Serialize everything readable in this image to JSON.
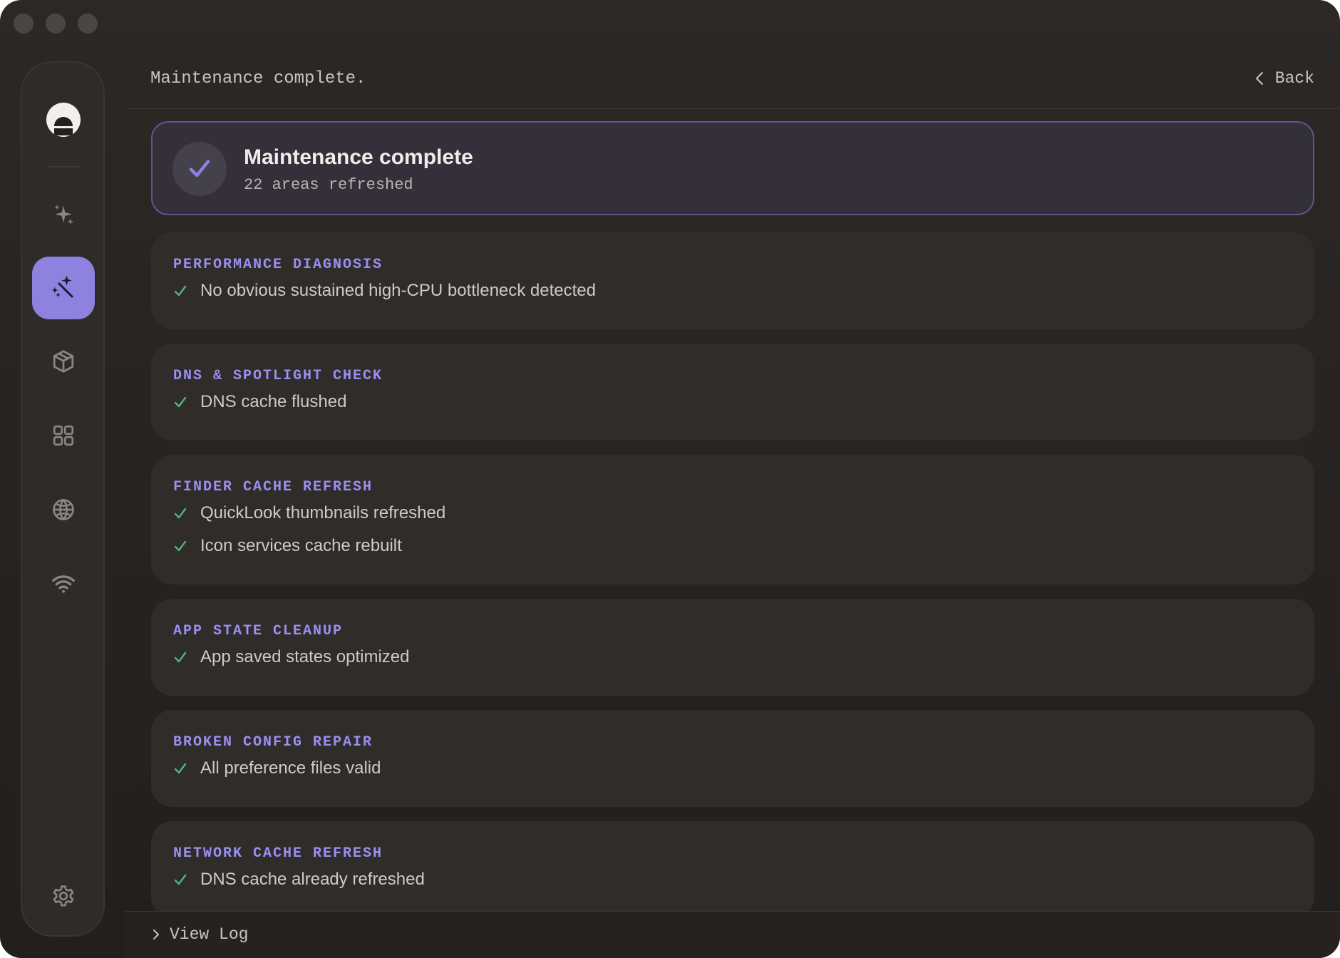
{
  "header": {
    "title": "Maintenance complete.",
    "back_label": "Back"
  },
  "summary": {
    "title": "Maintenance complete",
    "subtitle": "22 areas refreshed"
  },
  "sidebar": {
    "items": [
      {
        "icon": "sparkles-icon",
        "active": false
      },
      {
        "icon": "magic-wand-icon",
        "active": true
      },
      {
        "icon": "package-icon",
        "active": false
      },
      {
        "icon": "grid-icon",
        "active": false
      },
      {
        "icon": "globe-icon",
        "active": false
      },
      {
        "icon": "wifi-icon",
        "active": false
      }
    ],
    "settings_icon": "gear-icon"
  },
  "sections": [
    {
      "title": "PERFORMANCE DIAGNOSIS",
      "items": [
        "No obvious sustained high-CPU bottleneck detected"
      ]
    },
    {
      "title": "DNS & SPOTLIGHT CHECK",
      "items": [
        "DNS cache flushed"
      ]
    },
    {
      "title": "FINDER CACHE REFRESH",
      "items": [
        "QuickLook thumbnails refreshed",
        "Icon services cache rebuilt"
      ]
    },
    {
      "title": "APP STATE CLEANUP",
      "items": [
        "App saved states optimized"
      ]
    },
    {
      "title": "BROKEN CONFIG REPAIR",
      "items": [
        "All preference files valid"
      ]
    },
    {
      "title": "NETWORK CACHE REFRESH",
      "items": [
        "DNS cache already refreshed"
      ]
    }
  ],
  "footer": {
    "view_log_label": "View Log"
  },
  "colors": {
    "accent": "#8d82e0",
    "section_title": "#9a8ff2",
    "check_green": "#4fb87a"
  }
}
